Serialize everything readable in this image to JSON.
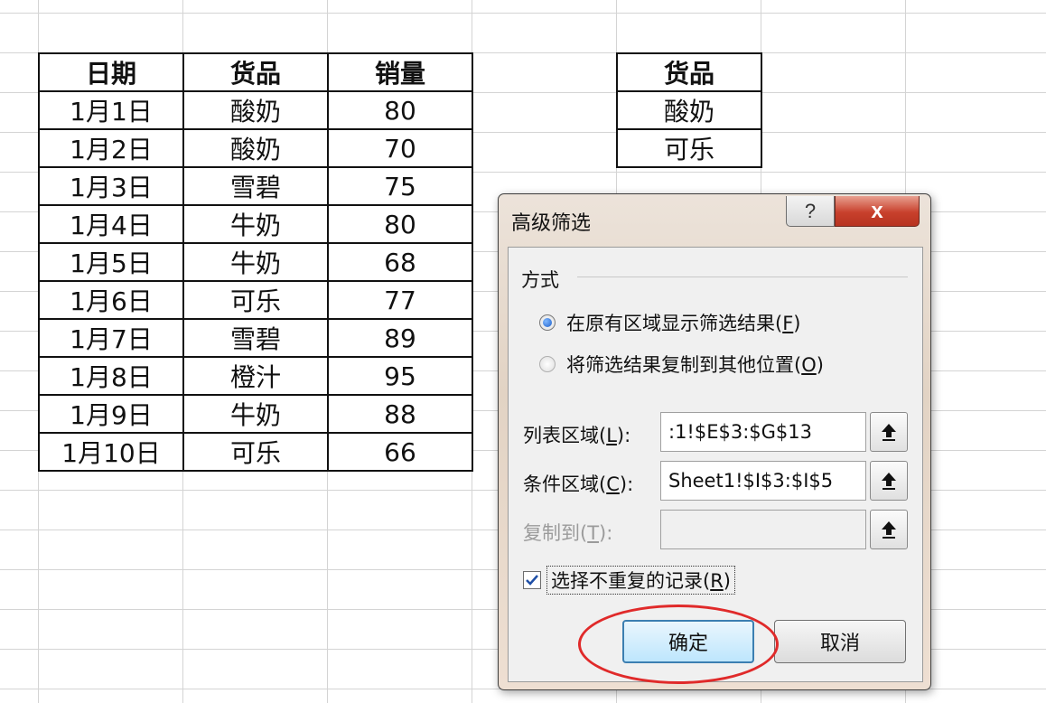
{
  "data_table": {
    "headers": [
      "日期",
      "货品",
      "销量"
    ],
    "rows": [
      [
        "1月1日",
        "酸奶",
        "80"
      ],
      [
        "1月2日",
        "酸奶",
        "70"
      ],
      [
        "1月3日",
        "雪碧",
        "75"
      ],
      [
        "1月4日",
        "牛奶",
        "80"
      ],
      [
        "1月5日",
        "牛奶",
        "68"
      ],
      [
        "1月6日",
        "可乐",
        "77"
      ],
      [
        "1月7日",
        "雪碧",
        "89"
      ],
      [
        "1月8日",
        "橙汁",
        "95"
      ],
      [
        "1月9日",
        "牛奶",
        "88"
      ],
      [
        "1月10日",
        "可乐",
        "66"
      ]
    ]
  },
  "criteria_table": {
    "header": "货品",
    "rows": [
      "酸奶",
      "可乐"
    ]
  },
  "dialog": {
    "title": "高级筛选",
    "help_glyph": "?",
    "close_glyph": "x",
    "group_label": "方式",
    "radio_inplace": {
      "label": "在原有区域显示筛选结果(",
      "key": "F",
      "suffix": ")",
      "checked": true
    },
    "radio_copy": {
      "label": "将筛选结果复制到其他位置(",
      "key": "O",
      "suffix": ")",
      "checked": false
    },
    "list_range": {
      "label": "列表区域(",
      "key": "L",
      "suffix": "):",
      "value": ":1!$E$3:$G$13"
    },
    "criteria_range": {
      "label": "条件区域(",
      "key": "C",
      "suffix": "):",
      "value": "Sheet1!$I$3:$I$5"
    },
    "copy_to": {
      "label": "复制到(",
      "key": "T",
      "suffix": "):",
      "value": ""
    },
    "unique_checkbox": {
      "label": "选择不重复的记录(",
      "key": "R",
      "suffix": ")",
      "checked": true
    },
    "ok_label": "确定",
    "cancel_label": "取消"
  },
  "colors": {
    "highlight_ring": "#e02a2a",
    "close_button": "#c8402c",
    "radio_selected": "#1e5fc9"
  }
}
